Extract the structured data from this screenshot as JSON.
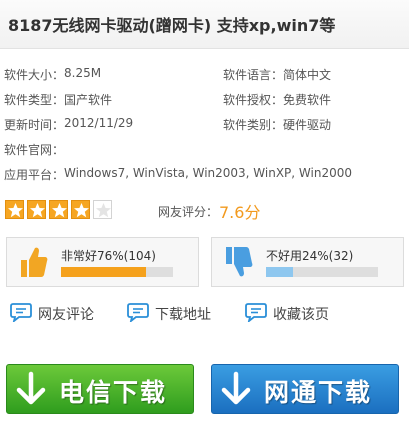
{
  "title": "8187无线网卡驱动(蹭网卡) 支持xp,win7等",
  "info": {
    "size_label": "软件大小：",
    "size_value": "8.25M",
    "lang_label": "软件语言：",
    "lang_value": "简体中文",
    "type_label": "软件类型：",
    "type_value": "国产软件",
    "license_label": "软件授权：",
    "license_value": "免费软件",
    "updated_label": "更新时间：",
    "updated_value": "2012/11/29",
    "category_label": "软件类别：",
    "category_value": "硬件驱动",
    "website_label": "软件官网：",
    "website_value": "",
    "platform_label": "应用平台：",
    "platform_value": "Windows7, WinVista, Win2003, WinXP, Win2000"
  },
  "rating": {
    "stars_filled": 4,
    "stars_total": 5,
    "label": "网友评分：",
    "score": "7.6分"
  },
  "votes": {
    "good_text": "非常好76%(104)",
    "good_percent": 76,
    "bad_text": "不好用24%(32)",
    "bad_percent": 24
  },
  "actions": {
    "comment": "网友评论",
    "download_address": "下载地址",
    "favorite": "收藏该页"
  },
  "downloads": {
    "telecom": "电信下载",
    "netcom": "网通下载"
  },
  "colors": {
    "accent_orange": "#f29a1e",
    "bar_good": "#f5a11c",
    "bar_bad": "#8ec7ef",
    "thumb_up": "#f2a623",
    "thumb_down": "#4a9ee0",
    "download_green": "#3aa62a",
    "download_blue": "#2a86d4"
  },
  "icons": {
    "thumb_up": "thumbs-up-icon",
    "thumb_down": "thumbs-down-icon",
    "comment": "speech-bubble-icon",
    "download": "download-arrow-icon"
  }
}
